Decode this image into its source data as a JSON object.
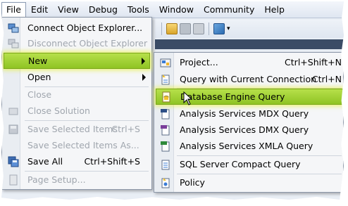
{
  "menubar": {
    "items": [
      "File",
      "Edit",
      "View",
      "Debug",
      "Tools",
      "Window",
      "Community",
      "Help"
    ]
  },
  "file_menu": {
    "items": [
      {
        "label": "Connect Object Explorer...",
        "shortcut": "",
        "icon": "connect-icon",
        "disabled": false
      },
      {
        "label": "Disconnect Object Explorer",
        "shortcut": "",
        "icon": "disconnect-icon",
        "disabled": true
      },
      {
        "label": "New",
        "shortcut": "",
        "icon": "",
        "disabled": false,
        "submenu": true,
        "highlighted": true
      },
      {
        "label": "Open",
        "shortcut": "",
        "icon": "",
        "disabled": false,
        "submenu": true
      },
      {
        "label": "Close",
        "shortcut": "",
        "icon": "",
        "disabled": true
      },
      {
        "label": "Close Solution",
        "shortcut": "",
        "icon": "close-solution-icon",
        "disabled": true
      },
      {
        "label": "Save Selected Items",
        "shortcut": "Ctrl+S",
        "icon": "save-icon",
        "disabled": true
      },
      {
        "label": "Save Selected Items As...",
        "shortcut": "",
        "icon": "",
        "disabled": true
      },
      {
        "label": "Save All",
        "shortcut": "Ctrl+Shift+S",
        "icon": "save-all-icon",
        "disabled": false
      },
      {
        "label": "Page Setup...",
        "shortcut": "",
        "icon": "page-setup-icon",
        "disabled": true
      }
    ]
  },
  "new_submenu": {
    "items": [
      {
        "label": "Project...",
        "shortcut": "Ctrl+Shift+N",
        "icon": "project-icon"
      },
      {
        "label": "Query with Current Connection",
        "shortcut": "Ctrl+N",
        "icon": "query-current-icon"
      },
      {
        "label": "Database Engine Query",
        "shortcut": "",
        "icon": "database-engine-query-icon",
        "highlighted": true
      },
      {
        "label": "Analysis Services MDX Query",
        "shortcut": "",
        "icon": "mdx-query-icon"
      },
      {
        "label": "Analysis Services DMX Query",
        "shortcut": "",
        "icon": "dmx-query-icon"
      },
      {
        "label": "Analysis Services XMLA Query",
        "shortcut": "",
        "icon": "xmla-query-icon"
      },
      {
        "label": "SQL Server Compact Query",
        "shortcut": "",
        "icon": "compact-query-icon"
      },
      {
        "label": "Policy",
        "shortcut": "",
        "icon": "policy-icon"
      }
    ]
  },
  "colors": {
    "highlight": "#9fd032",
    "highlight_glow": "#e6f050",
    "menu_bg": "#f5f6f8",
    "disabled_text": "#a0a6ae"
  }
}
